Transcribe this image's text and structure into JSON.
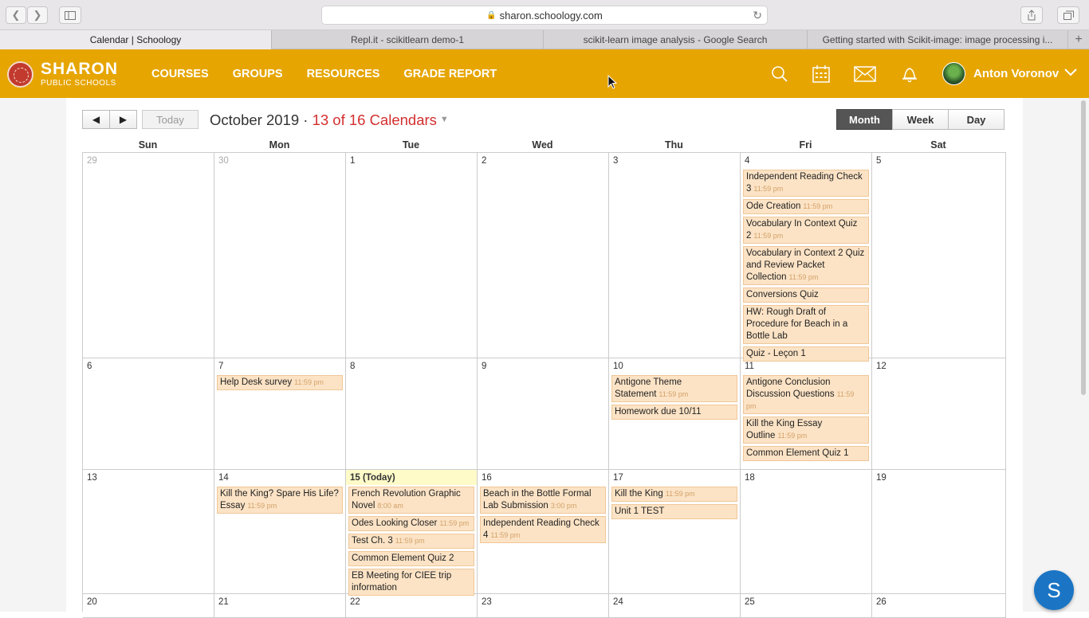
{
  "browser": {
    "url": "sharon.schoology.com",
    "tabs": [
      {
        "title": "Calendar | Schoology"
      },
      {
        "title": "Repl.it - scikitlearn demo-1"
      },
      {
        "title": "scikit-learn image analysis - Google Search"
      },
      {
        "title": "Getting started with Scikit-image: image processing i..."
      }
    ]
  },
  "header": {
    "logo_name": "SHARON",
    "logo_sub": "PUBLIC SCHOOLS",
    "nav": [
      "COURSES",
      "GROUPS",
      "RESOURCES",
      "GRADE REPORT"
    ],
    "user_name": "Anton Voronov",
    "icons": [
      "search-icon",
      "calendar-icon",
      "mail-icon",
      "bell-icon"
    ]
  },
  "calendar": {
    "prev_label": "◀",
    "next_label": "▶",
    "today_label": "Today",
    "month_title": "October 2019",
    "separator": " · ",
    "calendars_count": "13 of 16 Calendars",
    "views": [
      "Month",
      "Week",
      "Day"
    ],
    "active_view": "Month",
    "weekdays": [
      "Sun",
      "Mon",
      "Tue",
      "Wed",
      "Thu",
      "Fri",
      "Sat"
    ],
    "weeks": [
      {
        "days": [
          {
            "label": "29",
            "dim": true,
            "events": []
          },
          {
            "label": "30",
            "dim": true,
            "events": []
          },
          {
            "label": "1",
            "events": []
          },
          {
            "label": "2",
            "events": []
          },
          {
            "label": "3",
            "events": []
          },
          {
            "label": "4",
            "events": [
              {
                "title": "Independent Reading Check 3",
                "time": "11:59 pm"
              },
              {
                "title": "Ode Creation",
                "time": "11:59 pm"
              },
              {
                "title": "Vocabulary In Context Quiz 2",
                "time": "11:59 pm"
              },
              {
                "title": "Vocabulary in Context 2 Quiz and Review Packet Collection",
                "time": "11:59 pm"
              },
              {
                "title": "Conversions Quiz",
                "time": ""
              },
              {
                "title": "HW: Rough Draft of Procedure for Beach in a Bottle Lab",
                "time": ""
              },
              {
                "title": "Quiz - Leçon 1",
                "time": ""
              }
            ]
          },
          {
            "label": "5",
            "events": []
          }
        ]
      },
      {
        "days": [
          {
            "label": "6",
            "events": []
          },
          {
            "label": "7",
            "events": [
              {
                "title": "Help Desk survey",
                "time": "11:59 pm"
              }
            ]
          },
          {
            "label": "8",
            "events": []
          },
          {
            "label": "9",
            "events": []
          },
          {
            "label": "10",
            "events": [
              {
                "title": "Antigone Theme Statement",
                "time": "11:59 pm"
              },
              {
                "title": "Homework due 10/11",
                "time": ""
              }
            ]
          },
          {
            "label": "11",
            "events": [
              {
                "title": "Antigone Conclusion Discussion Questions",
                "time": "11:59 pm"
              },
              {
                "title": "Kill the King Essay Outline",
                "time": "11:59 pm"
              },
              {
                "title": "Common Element Quiz 1",
                "time": ""
              }
            ]
          },
          {
            "label": "12",
            "events": []
          }
        ]
      },
      {
        "days": [
          {
            "label": "13",
            "events": []
          },
          {
            "label": "14",
            "events": [
              {
                "title": "Kill the King? Spare His Life? Essay",
                "time": "11:59 pm"
              }
            ]
          },
          {
            "label": "15 (Today)",
            "today": true,
            "events": [
              {
                "title": "French Revolution Graphic Novel",
                "time": "8:00 am"
              },
              {
                "title": "Odes Looking Closer",
                "time": "11:59 pm"
              },
              {
                "title": "Test Ch. 3",
                "time": "11:59 pm"
              },
              {
                "title": "Common Element Quiz 2",
                "time": ""
              },
              {
                "title": "EB Meeting for CIEE trip information",
                "time": ""
              }
            ]
          },
          {
            "label": "16",
            "events": [
              {
                "title": "Beach in the Bottle Formal Lab Submission",
                "time": "3:00 pm"
              },
              {
                "title": "Independent Reading Check 4",
                "time": "11:59 pm"
              }
            ]
          },
          {
            "label": "17",
            "events": [
              {
                "title": "Kill the King",
                "time": "11:59 pm"
              },
              {
                "title": "Unit 1 TEST",
                "time": ""
              }
            ]
          },
          {
            "label": "18",
            "events": []
          },
          {
            "label": "19",
            "events": []
          }
        ]
      },
      {
        "days": [
          {
            "label": "20",
            "events": []
          },
          {
            "label": "21",
            "events": []
          },
          {
            "label": "22",
            "events": []
          },
          {
            "label": "23",
            "events": []
          },
          {
            "label": "24",
            "events": []
          },
          {
            "label": "25",
            "events": []
          },
          {
            "label": "26",
            "events": []
          }
        ]
      }
    ]
  },
  "chat_button_label": "S",
  "colors": {
    "brand": "#e6a500",
    "event_bg": "#fce3c5",
    "accent_red": "#d22f2f",
    "today_bg": "#fffbc9"
  }
}
